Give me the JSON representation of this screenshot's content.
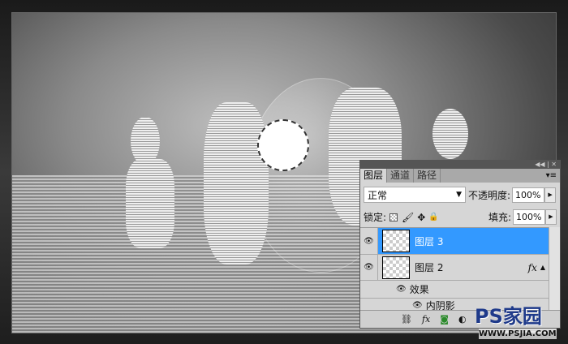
{
  "panel": {
    "tabs": [
      "图层",
      "通道",
      "路径"
    ],
    "blend_mode": "正常",
    "opacity_label": "不透明度:",
    "opacity": "100%",
    "lock_label": "锁定:",
    "fill_label": "填充:",
    "fill": "100%",
    "layers": [
      {
        "name": "图层 3",
        "selected": true
      },
      {
        "name": "图层 2",
        "selected": false,
        "fx": "fx"
      }
    ],
    "effects_label": "效果",
    "effect_item": "内阴影",
    "bottom_fx": "fx"
  },
  "watermark": {
    "logo": "PS家园",
    "url": "WWW.PSJIA.COM"
  },
  "colors": {
    "selected_row": "#3399ff",
    "panel_bg": "#d6d6d6"
  }
}
